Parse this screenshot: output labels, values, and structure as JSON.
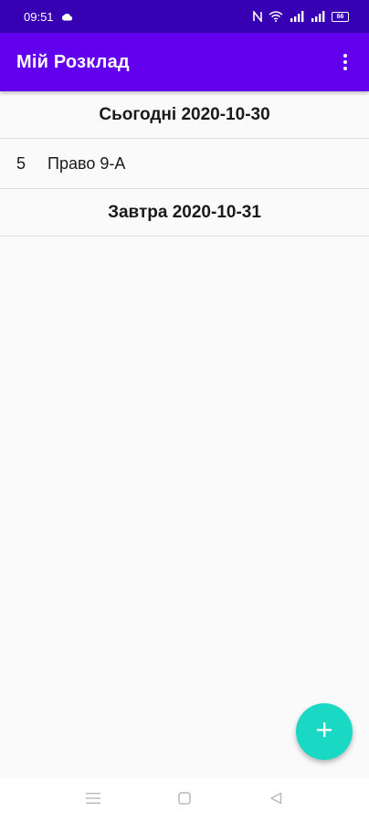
{
  "status_bar": {
    "time": "09:51",
    "battery": "66",
    "icons": [
      "cloud-icon",
      "nfc-icon",
      "wifi-icon",
      "signal-icon",
      "signal-icon",
      "battery-icon"
    ]
  },
  "app_bar": {
    "title": "Мій Розклад",
    "menu_icon": "more-vert-icon"
  },
  "schedule": {
    "today_header": "Сьогодні 2020-10-30",
    "today_lessons": [
      {
        "number": "5",
        "name": "Право 9-А"
      }
    ],
    "tomorrow_header": "Завтра 2020-10-31"
  },
  "fab": {
    "icon": "plus-icon"
  },
  "colors": {
    "status_bar": "#3700b3",
    "app_bar": "#6200ee",
    "fab": "#1ad9c4",
    "background": "#fafafa"
  }
}
